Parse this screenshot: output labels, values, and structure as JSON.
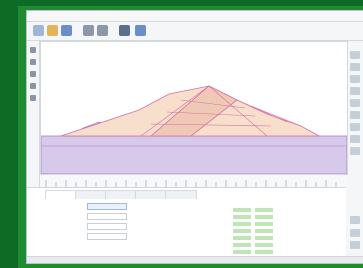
{
  "window": {
    "title": ""
  },
  "toolbar": {
    "buttons": [
      {
        "name": "new-icon",
        "color": "#9fb6d6"
      },
      {
        "name": "open-icon",
        "color": "#e0b55a"
      },
      {
        "name": "save-icon",
        "color": "#6a8fc6"
      },
      {
        "name": "undo-icon",
        "color": "#8c97a8"
      },
      {
        "name": "redo-icon",
        "color": "#8c97a8"
      },
      {
        "name": "select-icon",
        "color": "#5a6f8f"
      },
      {
        "name": "zoom-icon",
        "color": "#6a8fc6"
      }
    ]
  },
  "bottom": {
    "tabs": [
      "",
      "",
      "",
      "",
      ""
    ],
    "props": [
      {
        "label": "",
        "value": ""
      },
      {
        "label": "",
        "value": ""
      },
      {
        "label": "",
        "value": ""
      },
      {
        "label": "",
        "value": ""
      }
    ],
    "table": {
      "header": "",
      "rows": [
        {
          "name": "",
          "v1": "",
          "v2": ""
        },
        {
          "name": "",
          "v1": "",
          "v2": ""
        },
        {
          "name": "",
          "v1": "",
          "v2": ""
        },
        {
          "name": "",
          "v1": "",
          "v2": ""
        },
        {
          "name": "",
          "v1": "",
          "v2": ""
        },
        {
          "name": "",
          "v1": "",
          "v2": ""
        },
        {
          "name": "",
          "v1": "",
          "v2": ""
        }
      ]
    }
  },
  "colors": {
    "outer_border": "#0e6b25",
    "inner_border": "#1f8a2f",
    "dam_core": "#f0c9b6",
    "dam_shell": "#f7dfcb",
    "dam_outline": "#d46fa6",
    "foundation": "#d7c9ea",
    "foundation_line": "#b07acb",
    "water": "#b8b1e6"
  }
}
